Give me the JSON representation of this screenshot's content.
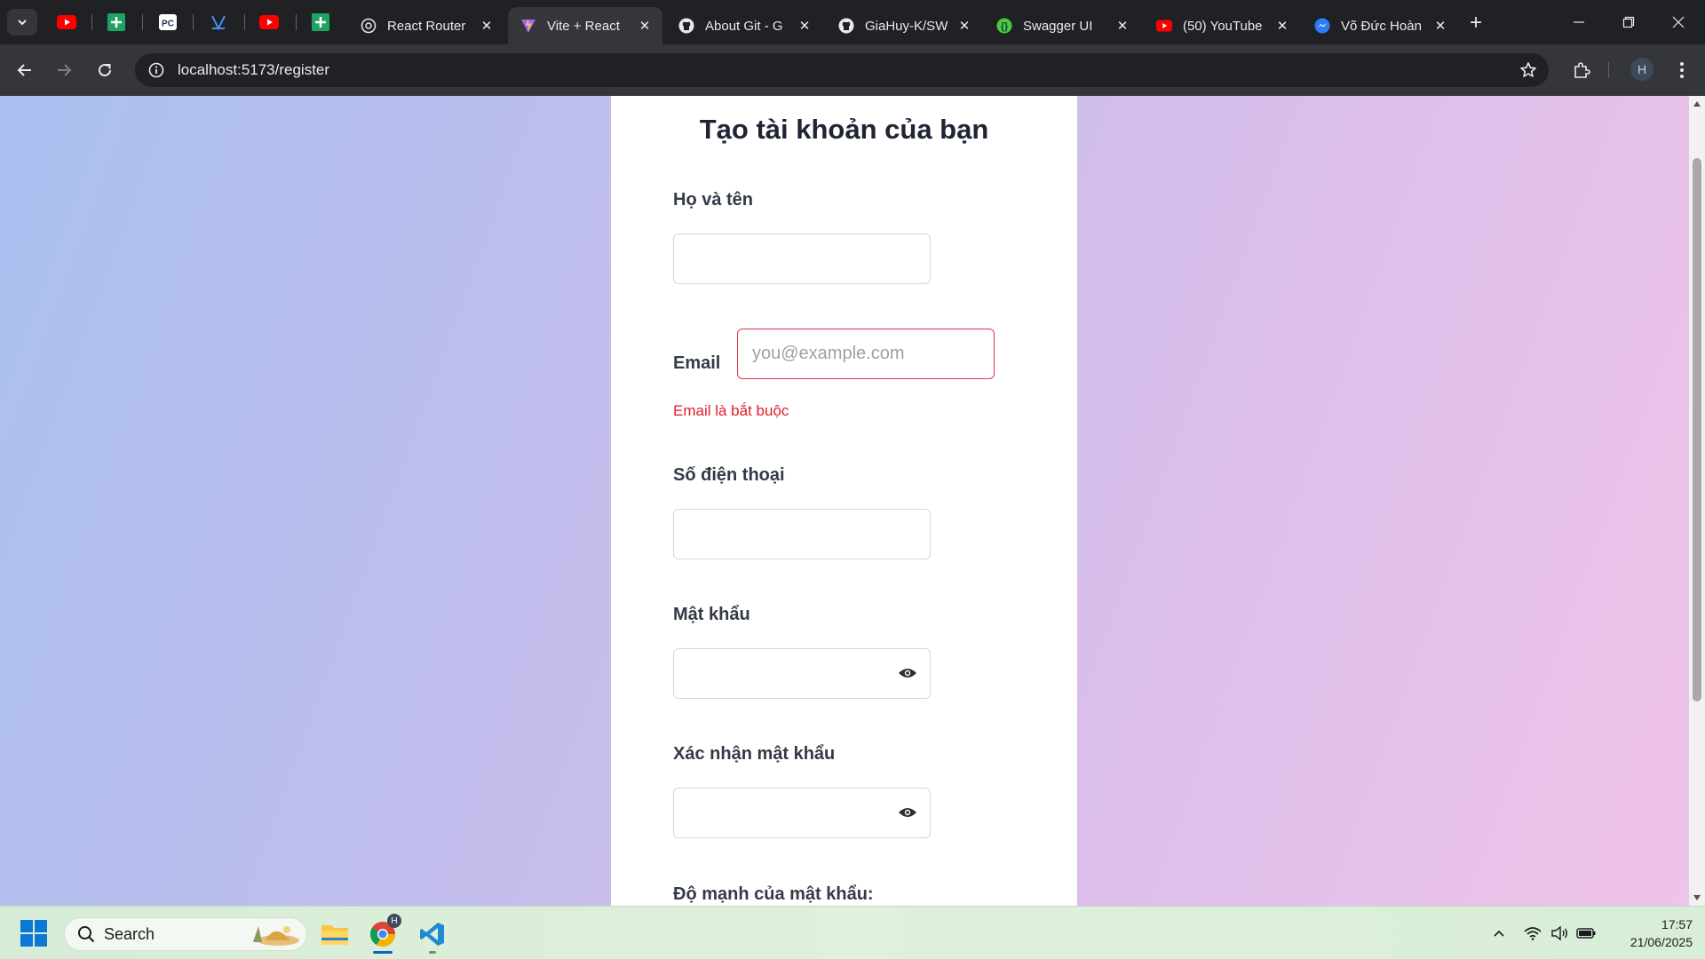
{
  "browser": {
    "tabs": [
      {
        "title": "",
        "icon": "youtube-icon",
        "pinned": true
      },
      {
        "title": "",
        "icon": "sheets-icon",
        "pinned": true
      },
      {
        "title": "",
        "icon": "pc-icon",
        "pinned": true
      },
      {
        "title": "",
        "icon": "vercel-icon",
        "pinned": true
      },
      {
        "title": "",
        "icon": "youtube-icon",
        "pinned": true
      },
      {
        "title": "",
        "icon": "sheets-icon",
        "pinned": true
      },
      {
        "title": "React Router",
        "icon": "react-router-icon"
      },
      {
        "title": "Vite + React",
        "icon": "vite-icon",
        "active": true
      },
      {
        "title": "About Git - G",
        "icon": "github-icon"
      },
      {
        "title": "GiaHuy-K/SW",
        "icon": "github-icon"
      },
      {
        "title": "Swagger UI",
        "icon": "swagger-icon"
      },
      {
        "title": "(50) YouTube",
        "icon": "youtube-icon"
      },
      {
        "title": "Võ Đức Hoàn",
        "icon": "messenger-icon"
      }
    ],
    "url": "localhost:5173/register",
    "profile_initial": "H"
  },
  "form": {
    "title": "Tạo tài khoản của bạn",
    "fullname_label": "Họ và tên",
    "email_label": "Email",
    "email_placeholder": "you@example.com",
    "email_error": "Email là bắt buộc",
    "phone_label": "Số điện thoại",
    "password_label": "Mật khẩu",
    "confirm_label": "Xác nhận mật khẩu",
    "strength_label": "Độ mạnh của mật khẩu:"
  },
  "taskbar": {
    "search_label": "Search",
    "time": "17:57",
    "date": "21/06/2025",
    "chrome_badge": "H"
  },
  "colors": {
    "error": "#e11d2a",
    "accent": "#0067c0"
  }
}
